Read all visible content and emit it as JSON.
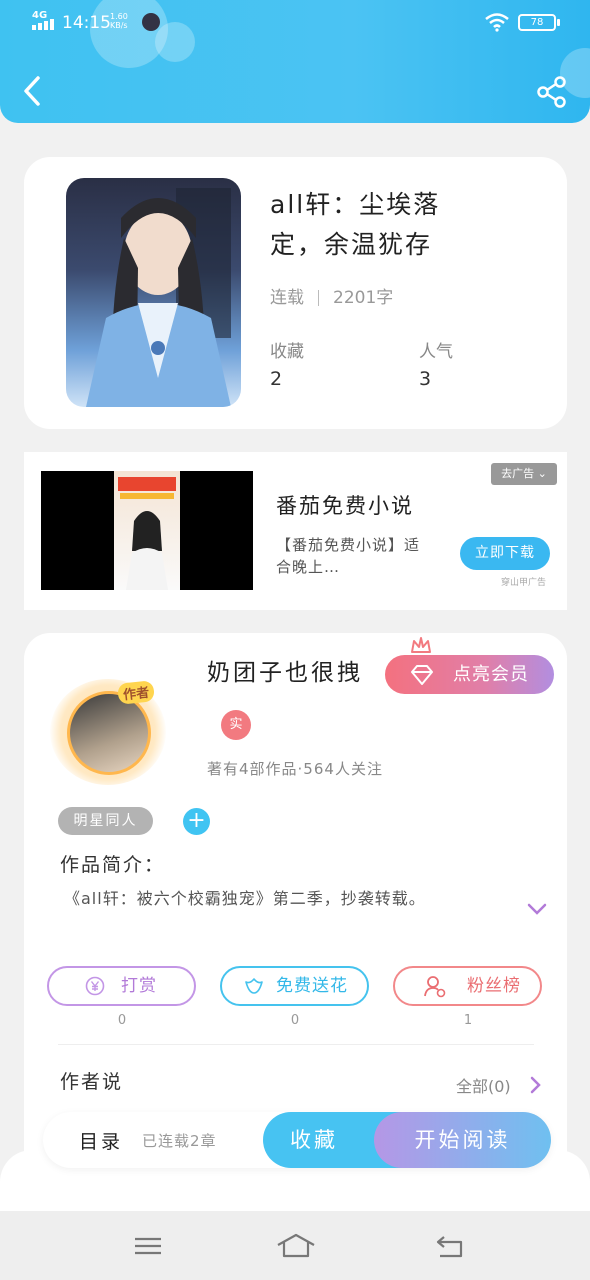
{
  "status_bar": {
    "network": "4G",
    "time": "14:15",
    "speed_value": "1.60",
    "speed_unit": "KB/s",
    "battery": "78"
  },
  "header": {
    "back_icon": "chevron-left-icon",
    "share_icon": "share-icon",
    "color": "#3fc2f1"
  },
  "book": {
    "title": "all轩：尘埃落定，余温犹存",
    "status": "连载",
    "word_count": "2201字",
    "stats": [
      {
        "label": "收藏",
        "value": "2"
      },
      {
        "label": "人气",
        "value": "3"
      }
    ]
  },
  "ad": {
    "close_label": "去广告",
    "title": "番茄免费小说",
    "description": "【番茄免费小说】适合晚上…",
    "cta": "立即下载",
    "source": "穿山甲广告"
  },
  "author": {
    "badge": "作者",
    "name": "奶团子也很拽",
    "vip_label": "点亮会员",
    "real_badge": "实",
    "stats": "著有4部作品·564人关注",
    "tag": "明星同人",
    "add_tag": "+",
    "intro_label": "作品简介：",
    "intro_text": "《all轩：被六个校霸独宠》第二季，抄袭转载。"
  },
  "actions": [
    {
      "label": "打赏",
      "icon": "yen-icon",
      "count": "0"
    },
    {
      "label": "免费送花",
      "icon": "flower-icon",
      "count": "0"
    },
    {
      "label": "粉丝榜",
      "icon": "fans-icon",
      "count": "1"
    }
  ],
  "author_say": {
    "label": "作者说",
    "all": "全部(0)"
  },
  "bottom_bar": {
    "toc_label": "目录",
    "toc_count": "已连载2章",
    "collect_label": "收藏",
    "read_label": "开始阅读"
  },
  "nav": {
    "menu_icon": "menu-icon",
    "home_icon": "home-icon",
    "back_icon": "back-icon"
  }
}
